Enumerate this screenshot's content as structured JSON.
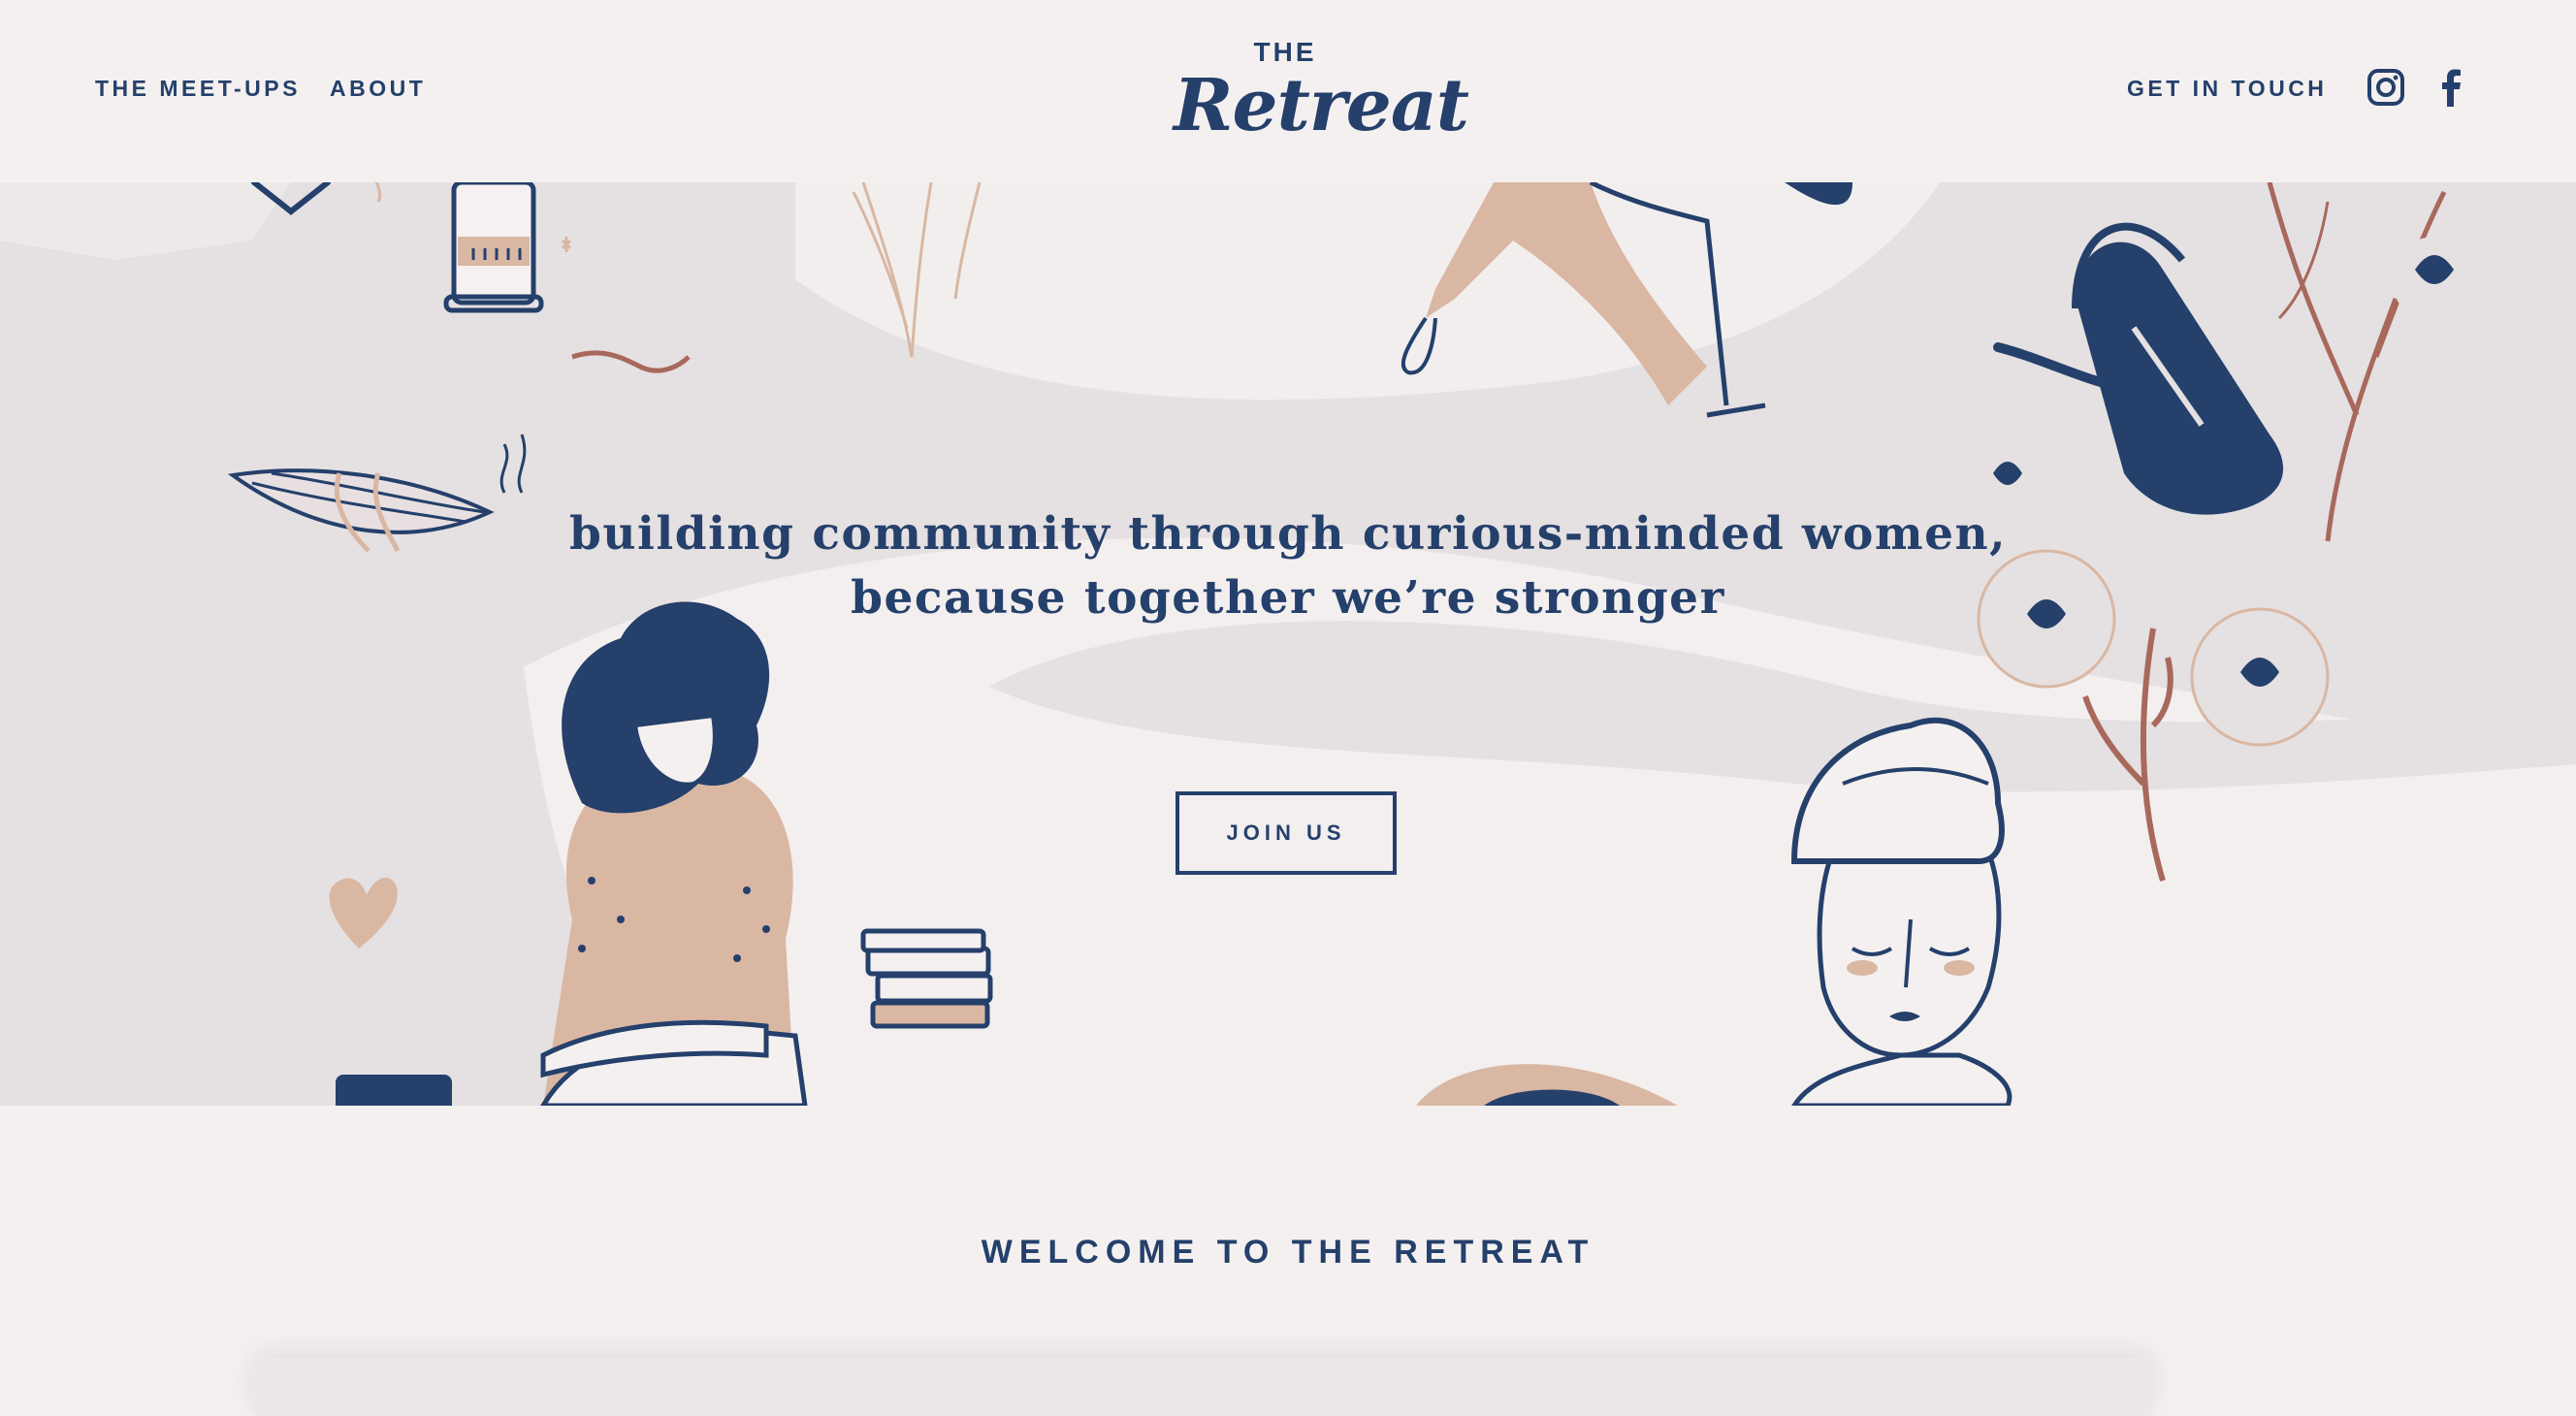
{
  "nav": {
    "left": [
      "THE MEET-UPS",
      "ABOUT"
    ],
    "right_label": "GET IN TOUCH"
  },
  "logo": {
    "top": "THE",
    "script": "Retreat"
  },
  "social": {
    "icons": [
      "instagram-icon",
      "facebook-icon"
    ]
  },
  "hero": {
    "tagline_line1": "building community through curious-minded women,",
    "tagline_line2": "because together we’re stronger",
    "cta_label": "JOIN US"
  },
  "welcome": {
    "heading": "WELCOME TO THE RETREAT"
  },
  "colors": {
    "navy": "#24406b",
    "blush": "#d9b7a3",
    "rust": "#a8685c",
    "page_bg": "#f5f0f0",
    "hero_bg": "#e5e0e1"
  }
}
